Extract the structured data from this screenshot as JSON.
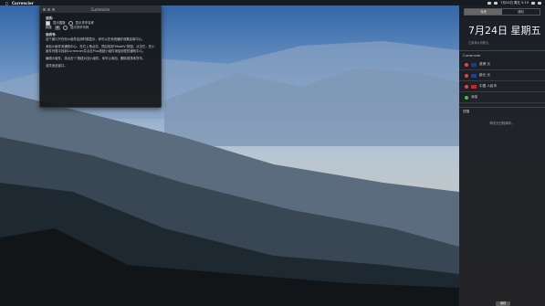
{
  "menubar": {
    "app_name": "Currencier",
    "clock": "7月24日 周五 5:19",
    "icons": [
      "apple-icon",
      "wifi-icon",
      "volume-icon",
      "search-icon",
      "notification-icon"
    ]
  },
  "prefs": {
    "title": "Currencier",
    "options_label": "选项:",
    "opt_flag": "显示国旗",
    "opt_name": "显示货币名称",
    "opt_code": "显示货币代码",
    "precision_label": "精度",
    "precision_value": "4",
    "help_label": "说明书:",
    "help_p1": "这个窗口只在你小组件启用时候显示，你可以在系统偏好设置启用中心。",
    "help_p2": "添加小组件到通知中心，在右上角点击，然后找到\"Modify\"按钮，点击它，在小组件列表中找到Currencier并点击Plus按钮小组件添加到您的通知中心。",
    "help_p3": "编辑小组件，将点击\"i\"按钮对当小组件，你可以添加，删除或排序货币。",
    "help_p4": "或关闭此窗口。"
  },
  "nc": {
    "tab_today": "今天",
    "tab_notifications": "通知",
    "date_big": "7月24日 星期五",
    "lunar": "乙未年六月初九",
    "widget_title": "Currencier",
    "currencies": [
      {
        "name": "英镑 元",
        "flag": "uk"
      },
      {
        "name": "欧元 元",
        "flag": "eu"
      },
      {
        "name": "中国 人民币",
        "flag": "cn"
      }
    ],
    "add_label": "添加",
    "section_label": "提醒",
    "note": "明天无日程事件。",
    "edit_button": "编辑"
  },
  "colors": {
    "accent": "#3c3",
    "remove": "#e44"
  }
}
